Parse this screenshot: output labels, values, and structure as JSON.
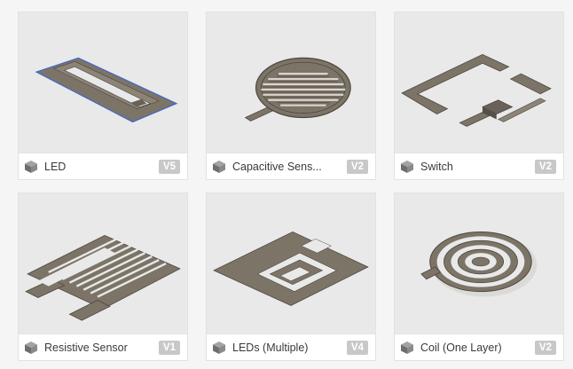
{
  "colors": {
    "card_background": "#e9e9e9",
    "trace_fill": "#7d7468",
    "trace_stroke": "#4c4640",
    "badge_background": "#c8c8c8",
    "selected_outline": "#3e66c8"
  },
  "designs": [
    {
      "name": "LED",
      "version": "V5",
      "icon": "component-cube-icon"
    },
    {
      "name": "Capacitive Sens...",
      "version": "V2",
      "icon": "component-cube-icon"
    },
    {
      "name": "Switch",
      "version": "V2",
      "icon": "component-cube-icon"
    },
    {
      "name": "Resistive Sensor",
      "version": "V1",
      "icon": "component-cube-icon"
    },
    {
      "name": "LEDs (Multiple)",
      "version": "V4",
      "icon": "component-cube-icon"
    },
    {
      "name": "Coil (One Layer)",
      "version": "V2",
      "icon": "component-cube-icon"
    }
  ]
}
